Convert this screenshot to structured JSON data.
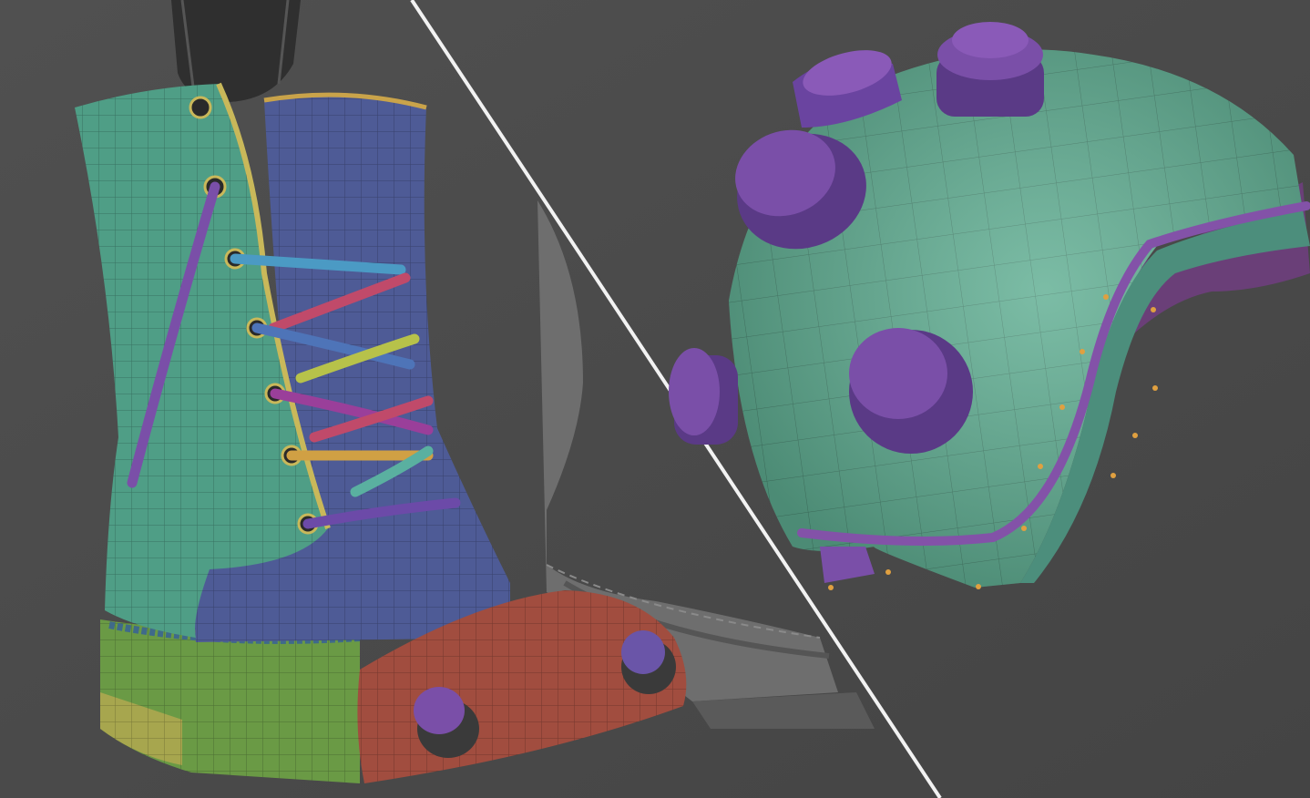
{
  "scene": {
    "background": "#4a4a4a",
    "palette": {
      "boot_green": "#4f9e86",
      "boot_blue": "#4e5b96",
      "toe_red": "#a14d3f",
      "sole_green": "#6a9a45",
      "sole_yellow": "#a7a64e",
      "stud_purple": "#7a4fa8",
      "stud_purple_dark": "#5a3a86",
      "helmet_green": "#5fae92",
      "helmet_rim": "#4c8e7c",
      "helmet_stripe": "#8352a8",
      "helmet_underside": "#6a3f78",
      "leg_grey": "#2f2f2f",
      "ghost_boot_grey": "#6e6e6e",
      "divider_white": "#f2f2f2",
      "lace_colors": [
        "#4b9ac4",
        "#c04a6a",
        "#4e74b8",
        "#b7c24a",
        "#9a3f9a",
        "#5ab0a0",
        "#6c8ad0",
        "#d0a044"
      ]
    },
    "panels": [
      {
        "name": "boot-uv-view"
      },
      {
        "name": "helmet-uv-view"
      }
    ]
  }
}
